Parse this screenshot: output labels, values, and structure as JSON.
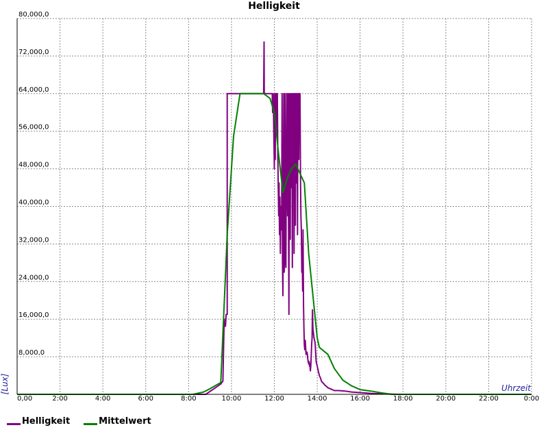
{
  "chart_data": {
    "type": "line",
    "title": "Helligkeit",
    "xlabel": "Uhrzeit",
    "ylabel": "[Lux]",
    "xlim": [
      0,
      24
    ],
    "ylim": [
      0,
      80000
    ],
    "grid": true,
    "legend_position": "bottom-left",
    "x_ticks": [
      "0,00",
      "2:00",
      "4:00",
      "6:00",
      "8:00",
      "10:00",
      "12:00",
      "14:00",
      "16:00",
      "18:00",
      "20:00",
      "22:00",
      "0:00"
    ],
    "y_ticks": [
      "8,000,0",
      "16,000,0",
      "24,000,0",
      "32,000,0",
      "40,000,0",
      "48,000,0",
      "56,000,0",
      "64,000,0",
      "72,000,0",
      "80,000,0"
    ],
    "series": [
      {
        "name": "Helligkeit",
        "color": "#800080",
        "x": [
          0,
          8.8,
          9.5,
          9.55,
          9.6,
          9.65,
          9.7,
          9.72,
          9.75,
          9.8,
          9.8,
          11.5,
          11.5,
          11.52,
          11.53,
          11.55,
          11.6,
          11.9,
          11.92,
          11.95,
          12.0,
          12.02,
          12.04,
          12.06,
          12.08,
          12.1,
          12.12,
          12.14,
          12.16,
          12.18,
          12.2,
          12.22,
          12.24,
          12.26,
          12.28,
          12.3,
          12.32,
          12.34,
          12.36,
          12.38,
          12.4,
          12.42,
          12.44,
          12.46,
          12.48,
          12.5,
          12.52,
          12.54,
          12.56,
          12.58,
          12.6,
          12.62,
          12.64,
          12.66,
          12.68,
          12.7,
          12.72,
          12.74,
          12.76,
          12.78,
          12.8,
          12.82,
          12.84,
          12.86,
          12.88,
          12.9,
          12.92,
          12.94,
          12.96,
          12.98,
          13.0,
          13.02,
          13.04,
          13.06,
          13.08,
          13.1,
          13.12,
          13.14,
          13.16,
          13.18,
          13.2,
          13.22,
          13.24,
          13.26,
          13.28,
          13.3,
          13.32,
          13.34,
          13.36,
          13.38,
          13.4,
          13.42,
          13.44,
          13.46,
          13.48,
          13.5,
          13.52,
          13.54,
          13.56,
          13.58,
          13.6,
          13.62,
          13.64,
          13.66,
          13.68,
          13.7,
          13.72,
          13.74,
          13.76,
          13.78,
          13.8,
          13.85,
          13.9,
          13.95,
          14.0,
          14.05,
          14.1,
          14.15,
          14.2,
          14.25,
          14.3,
          14.35,
          14.4,
          14.45,
          14.5,
          14.55,
          14.6,
          14.7,
          14.8,
          15.0,
          15.3,
          15.6,
          15.9,
          16.2,
          16.5,
          17.0,
          17.5,
          18.0,
          22.0,
          22.2,
          24.0
        ],
        "y": [
          0,
          0,
          2200,
          2500,
          2800,
          14000,
          16000,
          14500,
          17000,
          17000,
          64000,
          64000,
          64000,
          75000,
          64000,
          64000,
          64000,
          64000,
          60000,
          64000,
          48000,
          64000,
          50000,
          64000,
          58000,
          64000,
          55000,
          64000,
          52000,
          45000,
          38000,
          45000,
          34000,
          42000,
          30000,
          40000,
          37000,
          35000,
          64000,
          28000,
          21000,
          40000,
          64000,
          26000,
          30000,
          64000,
          29000,
          27000,
          50000,
          64000,
          44000,
          38000,
          64000,
          36000,
          17000,
          64000,
          47000,
          33000,
          64000,
          44000,
          56000,
          64000,
          27000,
          64000,
          55000,
          64000,
          30000,
          52000,
          64000,
          36000,
          64000,
          64000,
          45000,
          64000,
          34000,
          62000,
          64000,
          50000,
          64000,
          64000,
          64000,
          46000,
          38000,
          35000,
          26000,
          30000,
          22000,
          35000,
          19000,
          14000,
          10500,
          9500,
          11500,
          10000,
          8500,
          9000,
          9000,
          8500,
          7500,
          7000,
          6500,
          7000,
          6000,
          6500,
          5000,
          6000,
          8000,
          10500,
          12000,
          18000,
          14000,
          12000,
          11000,
          7000,
          6000,
          5000,
          4000,
          3500,
          2800,
          2500,
          2300,
          2000,
          1800,
          1600,
          1400,
          1300,
          1200,
          1000,
          800,
          800,
          700,
          500,
          400,
          300,
          200,
          100,
          50,
          0,
          0,
          0,
          0
        ]
      },
      {
        "name": "Mittelwert",
        "color": "#008000",
        "x": [
          0,
          8.2,
          8.7,
          9.0,
          9.5,
          9.8,
          10.1,
          10.4,
          11.5,
          11.8,
          12.0,
          12.2,
          12.4,
          12.6,
          12.8,
          13.0,
          13.2,
          13.4,
          13.6,
          14.0,
          14.1,
          14.5,
          14.8,
          15.2,
          15.6,
          16.0,
          16.5,
          17.0,
          17.5,
          24.0
        ],
        "y": [
          0,
          0,
          500,
          1200,
          2500,
          34000,
          55000,
          64000,
          64000,
          63000,
          60000,
          51000,
          43000,
          46000,
          48000,
          49000,
          47000,
          45000,
          30000,
          12000,
          10000,
          8500,
          5500,
          3000,
          1800,
          1000,
          700,
          300,
          0,
          0
        ]
      }
    ]
  }
}
